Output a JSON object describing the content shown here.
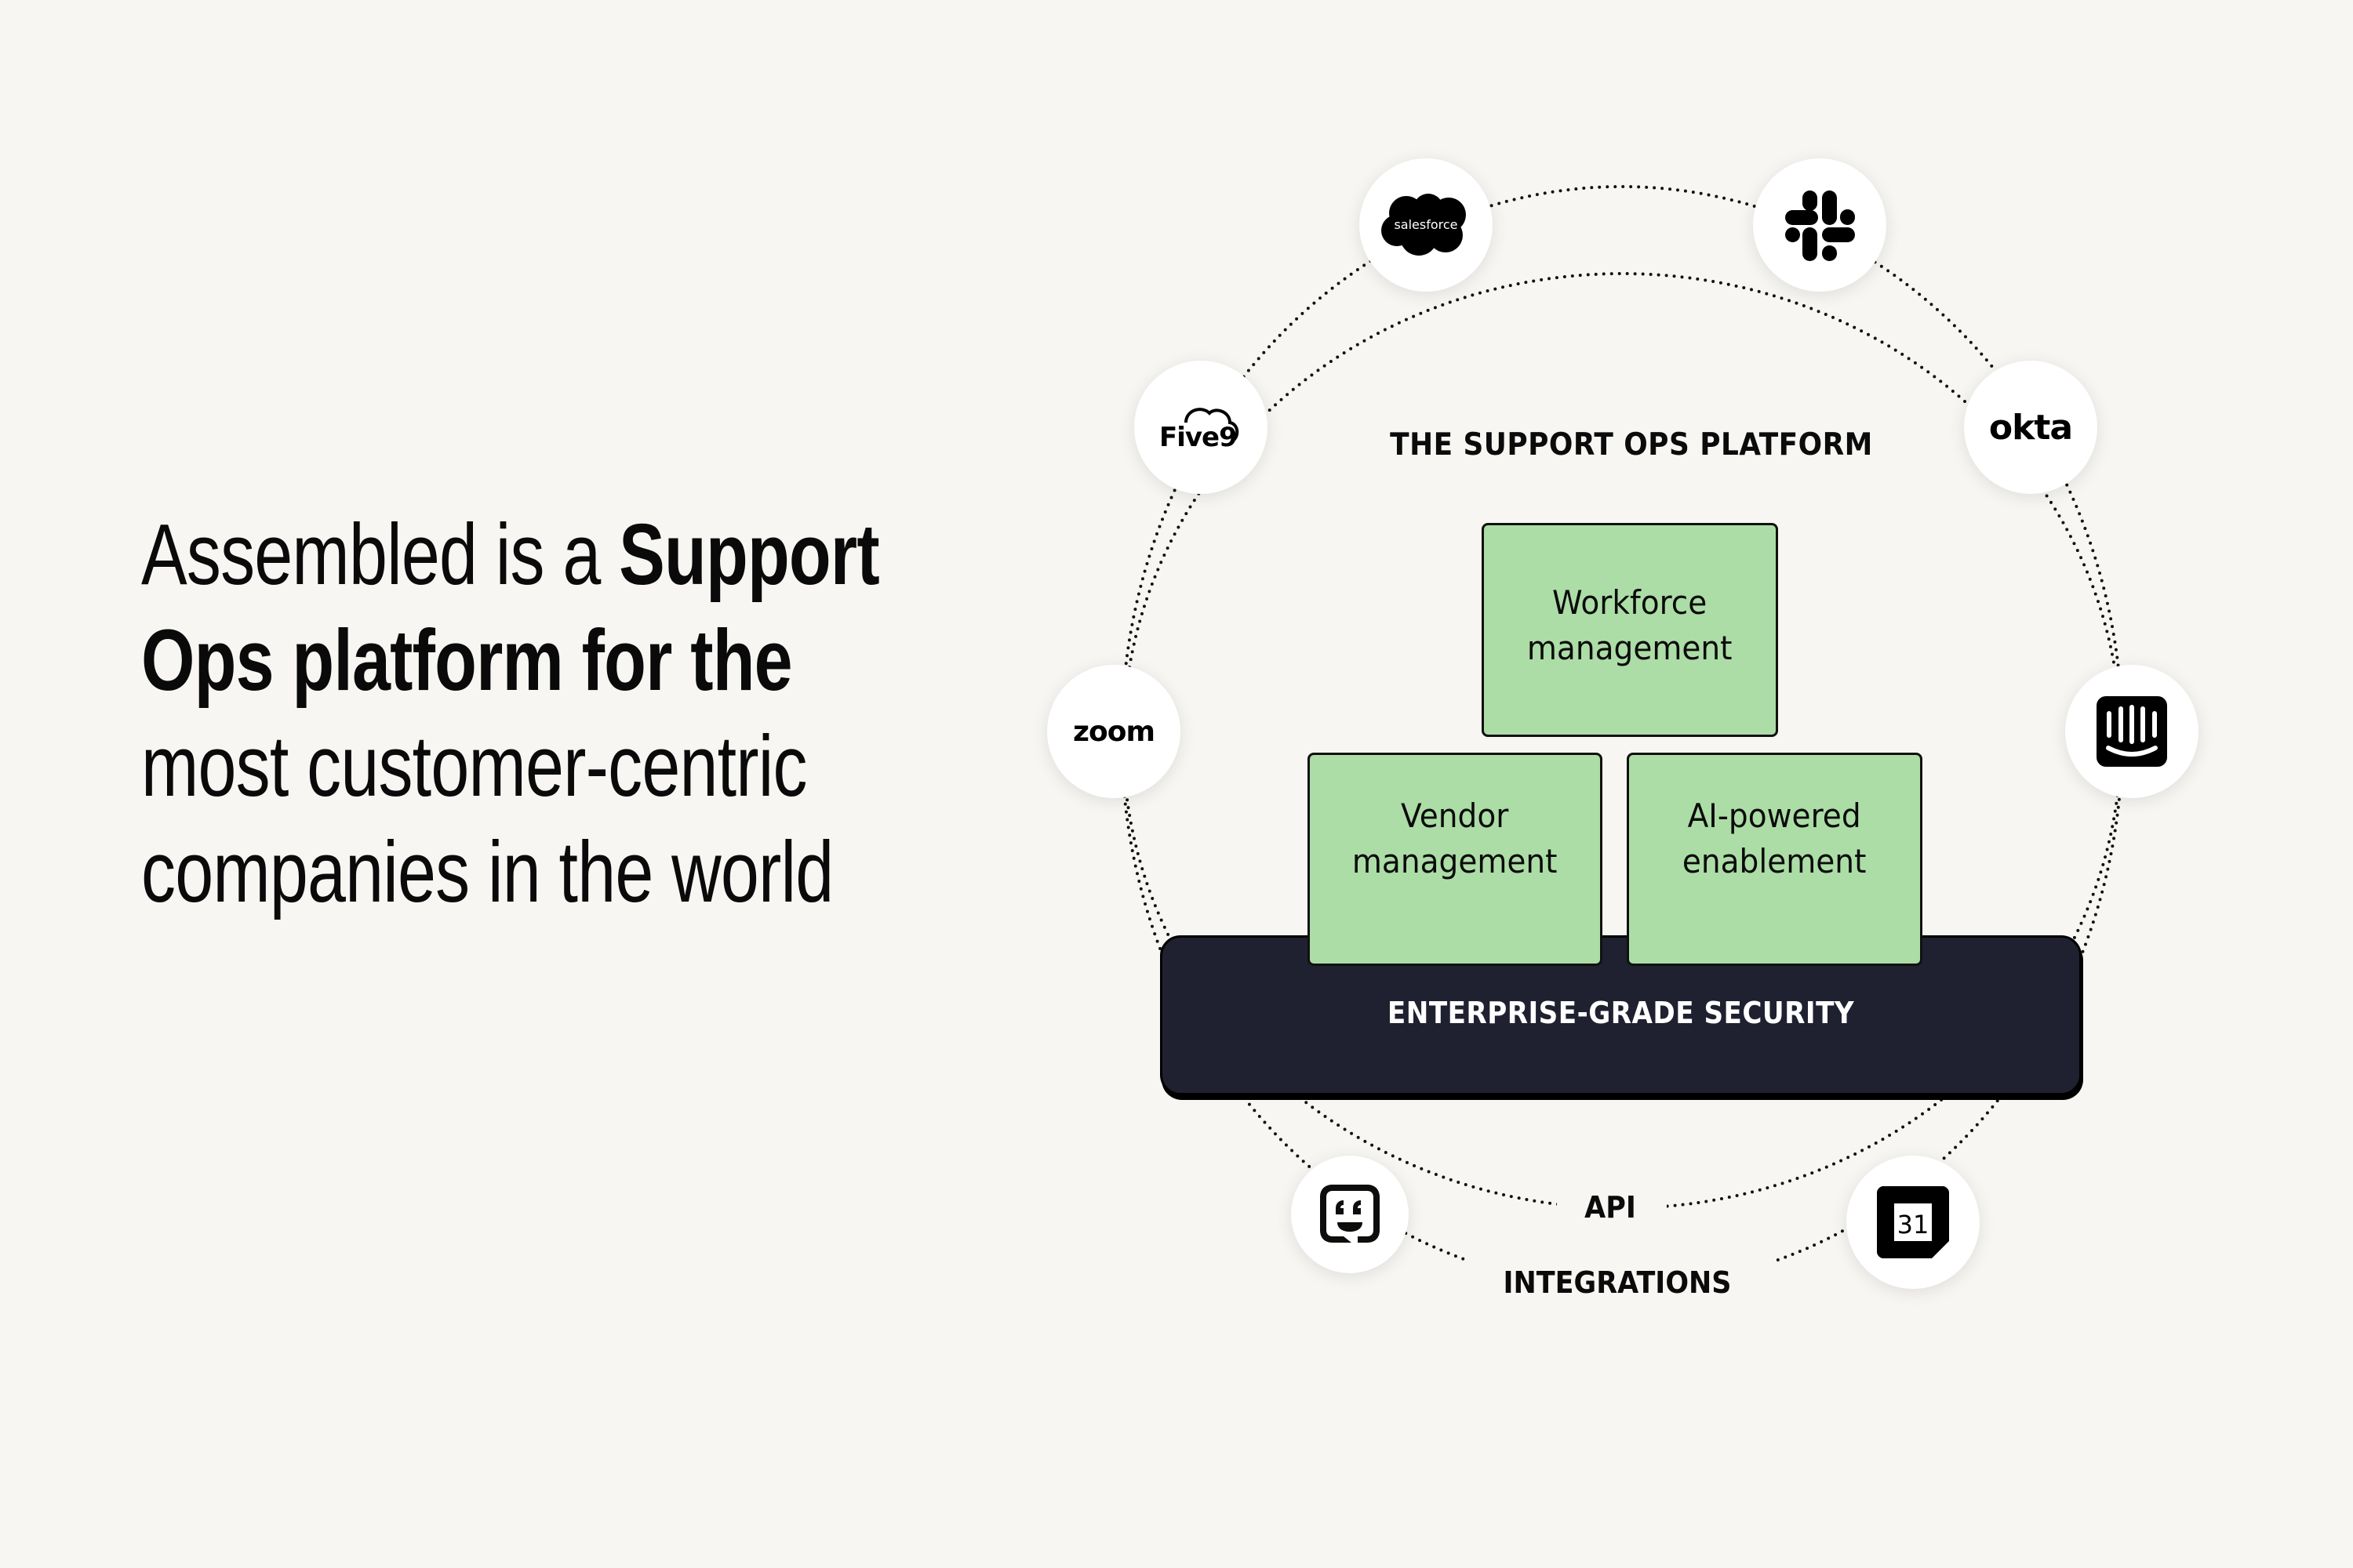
{
  "headline": {
    "lines": [
      {
        "regular": "Assembled is a ",
        "bold": "Support"
      },
      {
        "regular": "Ops platform for the",
        "bold": ""
      },
      {
        "regular": "most customer-centric",
        "bold": ""
      },
      {
        "regular": "companies in the world",
        "bold": ""
      }
    ]
  },
  "diagram": {
    "title": "THE SUPPORT OPS PLATFORM",
    "capabilities": [
      {
        "line1": "Workforce",
        "line2": "management"
      },
      {
        "line1": "Vendor",
        "line2": "management"
      },
      {
        "line1": "AI-powered",
        "line2": "enablement"
      }
    ],
    "foundation": "ENTERPRISE-GRADE SECURITY",
    "ring_labels": {
      "inner": "API",
      "outer": "INTEGRATIONS"
    },
    "integrations": [
      {
        "name": "Salesforce",
        "icon": "salesforce-cloud-icon",
        "text": "salesforce"
      },
      {
        "name": "Slack",
        "icon": "slack-hash-icon"
      },
      {
        "name": "Five9",
        "icon": "five9-cloud-icon",
        "text": "Five9"
      },
      {
        "name": "Okta",
        "icon": "okta-wordmark-icon",
        "text": "okta"
      },
      {
        "name": "Zoom",
        "icon": "zoom-wordmark-icon",
        "text": "zoom"
      },
      {
        "name": "Intercom",
        "icon": "intercom-face-icon"
      },
      {
        "name": "Chat",
        "icon": "chat-bubble-face-icon"
      },
      {
        "name": "Calendar",
        "icon": "calendar-31-icon",
        "text": "31"
      }
    ]
  },
  "colors": {
    "background": "#f7f6f2",
    "capability_fill": "#acdda6",
    "foundation_fill": "#1f2130",
    "ink": "#0a0a0a"
  }
}
